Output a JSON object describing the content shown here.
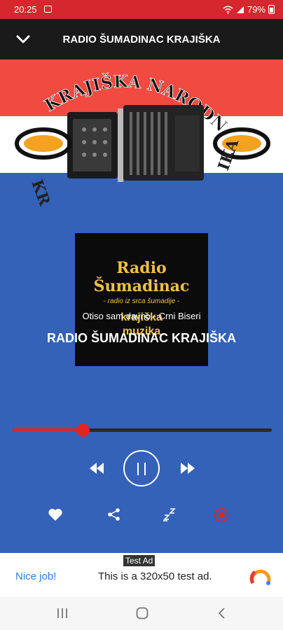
{
  "status_bar": {
    "time": "20:25",
    "battery": "79%",
    "icons": [
      "image-icon",
      "wifi-icon",
      "signal-icon",
      "battery-icon"
    ]
  },
  "header": {
    "title": "RADIO ŠUMADINAC KRAJIŠKA",
    "back_icon": "chevron-down-icon"
  },
  "banner": {
    "arc_text": "KRAJIŠKA NARODNA MUZIKA",
    "colors": [
      "#f14a41",
      "#ffffff",
      "#3462b9"
    ]
  },
  "cover": {
    "line1": "Radio",
    "line2": "Šumadinac",
    "line3": "- radio iz srca šumadije -",
    "line4": "krajiška",
    "line5": "muzika"
  },
  "now_playing": {
    "song": "Otiso sam davno - Crni Biseri",
    "station": "RADIO ŠUMADINAC KRAJIŠKA"
  },
  "player": {
    "progress": 0.27,
    "accent": "#e12424",
    "controls": [
      "rewind-icon",
      "pause-icon",
      "fast-forward-icon"
    ]
  },
  "actions": [
    "heart-icon",
    "share-icon",
    "sleep-timer-icon",
    "record-icon"
  ],
  "ad": {
    "label": "Test Ad",
    "cta": "Nice job!",
    "text": "This is a 320x50 test ad."
  },
  "nav": [
    "recents-icon",
    "home-icon",
    "back-icon"
  ]
}
